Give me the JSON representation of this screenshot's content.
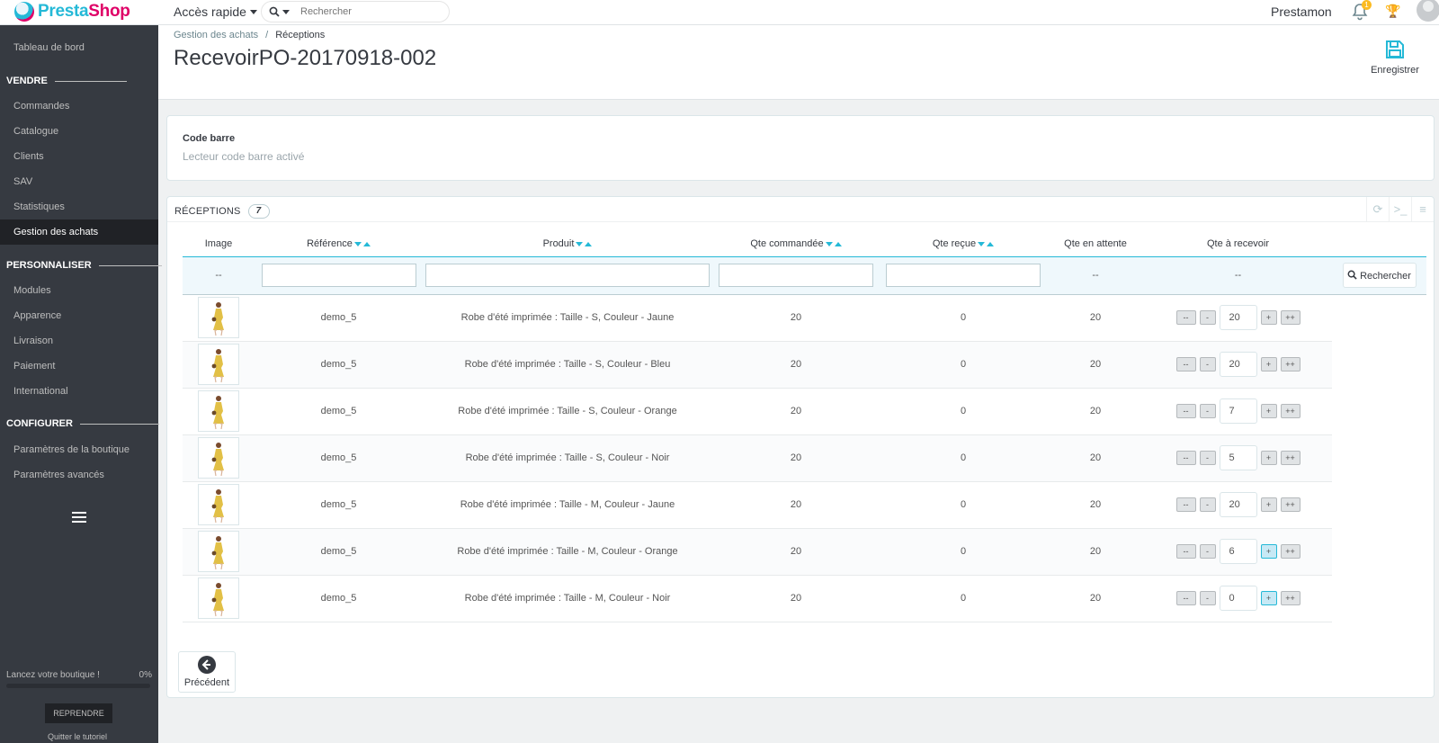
{
  "topbar": {
    "logo_prefix": "Presta",
    "logo_suffix": "Shop",
    "quick_access": "Accès rapide",
    "search_placeholder": "Rechercher",
    "user_name": "Prestamon",
    "notification_count": "1"
  },
  "sidebar": {
    "dashboard": "Tableau de bord",
    "section_sell": "VENDRE",
    "orders": "Commandes",
    "catalog": "Catalogue",
    "customers": "Clients",
    "service": "SAV",
    "stats": "Statistiques",
    "purchases": "Gestion des achats",
    "section_customize": "PERSONNALISER",
    "modules": "Modules",
    "appearance": "Apparence",
    "shipping": "Livraison",
    "payment": "Paiement",
    "international": "International",
    "section_configure": "CONFIGURER",
    "shop_params": "Paramètres de la boutique",
    "advanced_params": "Paramètres avancés",
    "launch_label": "Lancez votre boutique !",
    "launch_percent": "0%",
    "launch_progress": 0,
    "resume_button": "REPRENDRE",
    "quit_tutorial": "Quitter le tutoriel"
  },
  "header": {
    "breadcrumb_parent": "Gestion des achats",
    "breadcrumb_sep": "/",
    "breadcrumb_current": "Réceptions",
    "title": "RecevoirPO-20170918-002",
    "save_label": "Enregistrer"
  },
  "barcode": {
    "label": "Code barre",
    "hint": "Lecteur code barre activé"
  },
  "receptions": {
    "title": "RÉCEPTIONS",
    "count": "7",
    "columns": {
      "image": "Image",
      "reference": "Référence",
      "product": "Produit",
      "qty_ordered": "Qte commandée",
      "qty_received": "Qte reçue",
      "qty_pending": "Qte en attente",
      "qty_to_receive": "Qte à recevoir"
    },
    "filter_placeholder_image": "--",
    "filter_placeholder_pending": "--",
    "filter_placeholder_to_receive": "--",
    "search_button": "Rechercher",
    "btn_minus_minus": "--",
    "btn_minus": "-",
    "btn_plus": "+",
    "btn_plus_plus": "++",
    "rows": [
      {
        "reference": "demo_5",
        "product": "Robe d'été imprimée : Taille - S, Couleur - Jaune",
        "ordered": "20",
        "received": "0",
        "pending": "20",
        "to_receive": "20"
      },
      {
        "reference": "demo_5",
        "product": "Robe d'été imprimée : Taille - S, Couleur - Bleu",
        "ordered": "20",
        "received": "0",
        "pending": "20",
        "to_receive": "20"
      },
      {
        "reference": "demo_5",
        "product": "Robe d'été imprimée : Taille - S, Couleur - Orange",
        "ordered": "20",
        "received": "0",
        "pending": "20",
        "to_receive": "7"
      },
      {
        "reference": "demo_5",
        "product": "Robe d'été imprimée : Taille - S, Couleur - Noir",
        "ordered": "20",
        "received": "0",
        "pending": "20",
        "to_receive": "5"
      },
      {
        "reference": "demo_5",
        "product": "Robe d'été imprimée : Taille - M, Couleur - Jaune",
        "ordered": "20",
        "received": "0",
        "pending": "20",
        "to_receive": "20"
      },
      {
        "reference": "demo_5",
        "product": "Robe d'été imprimée : Taille - M, Couleur - Orange",
        "ordered": "20",
        "received": "0",
        "pending": "20",
        "to_receive": "6"
      },
      {
        "reference": "demo_5",
        "product": "Robe d'été imprimée : Taille - M, Couleur - Noir",
        "ordered": "20",
        "received": "0",
        "pending": "20",
        "to_receive": "0"
      }
    ],
    "back_button": "Précédent"
  },
  "colors": {
    "accent": "#25b9d7",
    "brand_pink": "#df0067",
    "sidebar_bg": "#363a41"
  }
}
